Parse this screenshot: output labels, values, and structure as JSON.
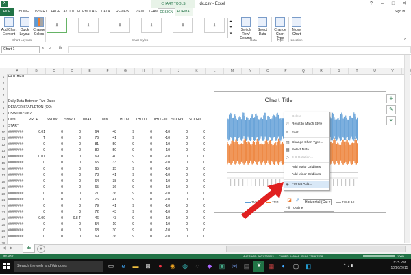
{
  "window": {
    "title": "dc.csv - Excel",
    "context_group": "CHART TOOLS",
    "min_icon": "minimize-icon",
    "max_icon": "maximize-icon",
    "close_icon": "close-icon",
    "help": "?"
  },
  "tabs": [
    "FILE",
    "HOME",
    "INSERT",
    "PAGE LAYOUT",
    "FORMULAS",
    "DATA",
    "REVIEW",
    "VIEW",
    "TEAM",
    "DESIGN",
    "FORMAT"
  ],
  "signin": "Sign in",
  "ribbon": {
    "add_chart_element": "Add Chart Element",
    "quick_layout": "Quick Layout",
    "change_colors": "Change Colors",
    "chart_layouts": "Chart Layouts",
    "chart_styles": "Chart Styles",
    "switch_row_col": "Switch Row/ Column",
    "select_data": "Select Data",
    "data_group": "Data",
    "change_chart_type": "Change Chart Type",
    "type_group": "Type",
    "move_chart": "Move Chart",
    "location_group": "Location"
  },
  "formula_bar": {
    "name_box": "Chart 1",
    "fx": "fx"
  },
  "columns": [
    "A",
    "B",
    "C",
    "D",
    "E",
    "F",
    "G",
    "H",
    "I",
    "J",
    "K",
    "L",
    "M",
    "N",
    "O",
    "P",
    "Q",
    "R",
    "S",
    "T",
    "U",
    "V",
    "W"
  ],
  "rows": {
    "numbers": [
      "1",
      "2",
      "3",
      "4",
      "5",
      "6",
      "7",
      "8",
      "9",
      "10",
      "11",
      "12",
      "13",
      "14",
      "15",
      "16",
      "17",
      "18",
      "19",
      "20",
      "21",
      "22",
      "23",
      "24",
      "25",
      "26",
      "27",
      "28",
      "29"
    ],
    "header_cells": [
      "Date",
      "PRCP",
      "SNOW",
      "SNWD",
      "TMAX",
      "TMIN",
      "THLD9",
      "THLD0",
      "THLD-10",
      "SCOR9",
      "SCOR0",
      "SCOR-10"
    ],
    "text": {
      "r1": "PATCHED",
      "r5": "Daily Data Between Two Dates",
      "r6": "DENVER STAPLETON (CO)",
      "r7": "USW00023062",
      "r10": "START"
    },
    "data": [
      [
        "########",
        "0.01",
        "0",
        "0",
        "64",
        "48",
        "9",
        "0",
        "-10",
        "0",
        "0",
        "0"
      ],
      [
        "########",
        "T",
        "0",
        "0",
        "76",
        "41",
        "9",
        "0",
        "-10",
        "0",
        "0",
        "0"
      ],
      [
        "########",
        "0",
        "0",
        "0",
        "81",
        "50",
        "9",
        "0",
        "-10",
        "0",
        "0",
        "0"
      ],
      [
        "########",
        "0",
        "0",
        "0",
        "80",
        "50",
        "9",
        "0",
        "-10",
        "0",
        "0",
        "0"
      ],
      [
        "########",
        "0.01",
        "0",
        "0",
        "69",
        "40",
        "9",
        "0",
        "-10",
        "0",
        "0",
        "0"
      ],
      [
        "########",
        "0",
        "0",
        "0",
        "65",
        "33",
        "9",
        "0",
        "-10",
        "0",
        "0",
        "0"
      ],
      [
        "########",
        "0",
        "0",
        "0",
        "65",
        "25",
        "9",
        "0",
        "-10",
        "0",
        "0",
        "0"
      ],
      [
        "########",
        "0",
        "0",
        "0",
        "78",
        "41",
        "9",
        "0",
        "-10",
        "0",
        "0",
        "0"
      ],
      [
        "########",
        "0",
        "0",
        "0",
        "64",
        "38",
        "9",
        "0",
        "-10",
        "0",
        "0",
        "0"
      ],
      [
        "########",
        "0",
        "0",
        "0",
        "65",
        "36",
        "9",
        "0",
        "-10",
        "0",
        "0",
        "0"
      ],
      [
        "########",
        "0",
        "0",
        "0",
        "71",
        "36",
        "9",
        "0",
        "-10",
        "0",
        "0",
        "0"
      ],
      [
        "########",
        "0",
        "0",
        "0",
        "76",
        "41",
        "9",
        "0",
        "-10",
        "0",
        "0",
        "0"
      ],
      [
        "########",
        "0",
        "0",
        "0",
        "79",
        "41",
        "9",
        "0",
        "-10",
        "0",
        "0",
        "0"
      ],
      [
        "########",
        "0",
        "0",
        "0",
        "72",
        "43",
        "9",
        "0",
        "-10",
        "0",
        "0",
        "0"
      ],
      [
        "########",
        "0.09",
        "0",
        "0.8 T",
        "46",
        "43",
        "9",
        "0",
        "-10",
        "0",
        "0",
        "0"
      ],
      [
        "########",
        "0",
        "0",
        "0",
        "54",
        "19",
        "9",
        "0",
        "-10",
        "0",
        "0",
        "0"
      ],
      [
        "########",
        "0",
        "0",
        "0",
        "68",
        "30",
        "9",
        "0",
        "-10",
        "0",
        "0",
        "0"
      ],
      [
        "########",
        "0",
        "0",
        "0",
        "69",
        "36",
        "9",
        "0",
        "-10",
        "0",
        "0",
        "0"
      ]
    ]
  },
  "chart": {
    "title": "Chart Title",
    "legend": [
      "TMAX",
      "TMIN",
      "THLD-10"
    ],
    "colors": {
      "tmax": "#5b9bd5",
      "tmin": "#ed7d31",
      "thld": "#a5a5a5"
    }
  },
  "context_menu": {
    "items": [
      "Delete",
      "Reset to Match Style",
      "Font...",
      "Change Chart Type...",
      "Select Data...",
      "3-D Rotation...",
      "Add Major Gridlines",
      "Add Minor Gridlines",
      "Format Axis..."
    ],
    "fill": "Fill",
    "outline": "Outline",
    "axis_select": "Horizontal (Cat"
  },
  "sheet_tab": "dc",
  "status": {
    "ready": "READY",
    "average": "AVERAGE: 5031.230012",
    "count": "COUNT: 146944",
    "sum": "SUM: 738397878",
    "zoom": "100%"
  },
  "taskbar": {
    "search": "Search the web and Windows",
    "time": "3:25 PM",
    "date": "10/26/2015"
  }
}
